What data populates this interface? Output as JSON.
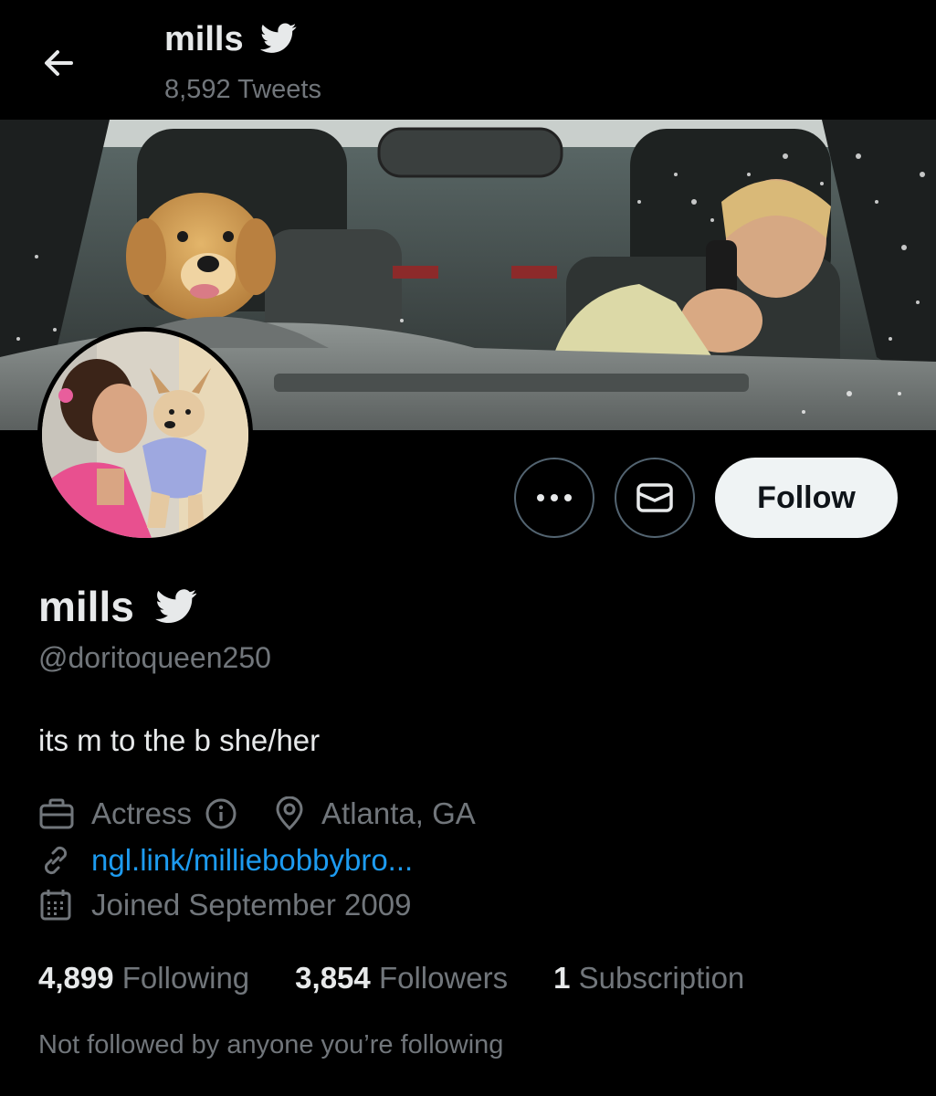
{
  "header": {
    "name": "mills",
    "tweet_count": "8,592 Tweets",
    "back_icon": "arrow-left-icon",
    "verified_icon": "twitter-bird-icon"
  },
  "banner": {
    "description_icon": "banner-photo"
  },
  "actions": {
    "more_icon": "more-dots-icon",
    "message_icon": "envelope-icon",
    "follow_label": "Follow"
  },
  "profile": {
    "name": "mills",
    "handle": "@doritoqueen250",
    "bio": "its m to the b she/her",
    "profession": "Actress",
    "location": "Atlanta, GA",
    "website": "ngl.link/milliebobbybro...",
    "joined": "Joined September 2009"
  },
  "stats": {
    "following_count": "4,899",
    "following_label": "Following",
    "followers_count": "3,854",
    "followers_label": "Followers",
    "subscription_count": "1",
    "subscription_label": "Subscription"
  },
  "footer": {
    "not_followed_text": "Not followed by anyone you’re following"
  },
  "colors": {
    "background": "#000000",
    "text_primary": "#e7e9ea",
    "text_secondary": "#71767b",
    "link": "#1d9bf0",
    "follow_button_bg": "#eff3f4"
  }
}
